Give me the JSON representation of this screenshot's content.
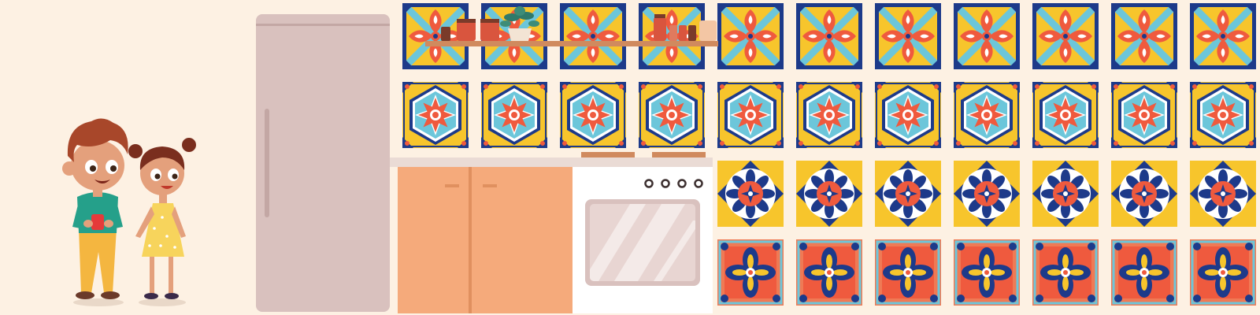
{
  "scene": {
    "background_color": "#fdf1e3",
    "tile_columns": 11,
    "tile_rows": 4,
    "tile_rows_patterns": [
      "blue-yellow-cross-tile",
      "yellow-hexagon-star-tile",
      "blue-flower-yellow-corner-tile",
      "orange-blue-quatrefoil-tile"
    ],
    "oven_knob_count": 4,
    "colors": {
      "fridge": "#d9c1be",
      "cabinet": "#f5aa7b",
      "oven": "#ffffff",
      "tile_blue": "#1d3a8a",
      "tile_yellow": "#f7c52c",
      "tile_red": "#ef5a3e",
      "tile_cyan": "#6cc6da"
    },
    "characters": [
      "boy-character",
      "girl-character"
    ]
  }
}
